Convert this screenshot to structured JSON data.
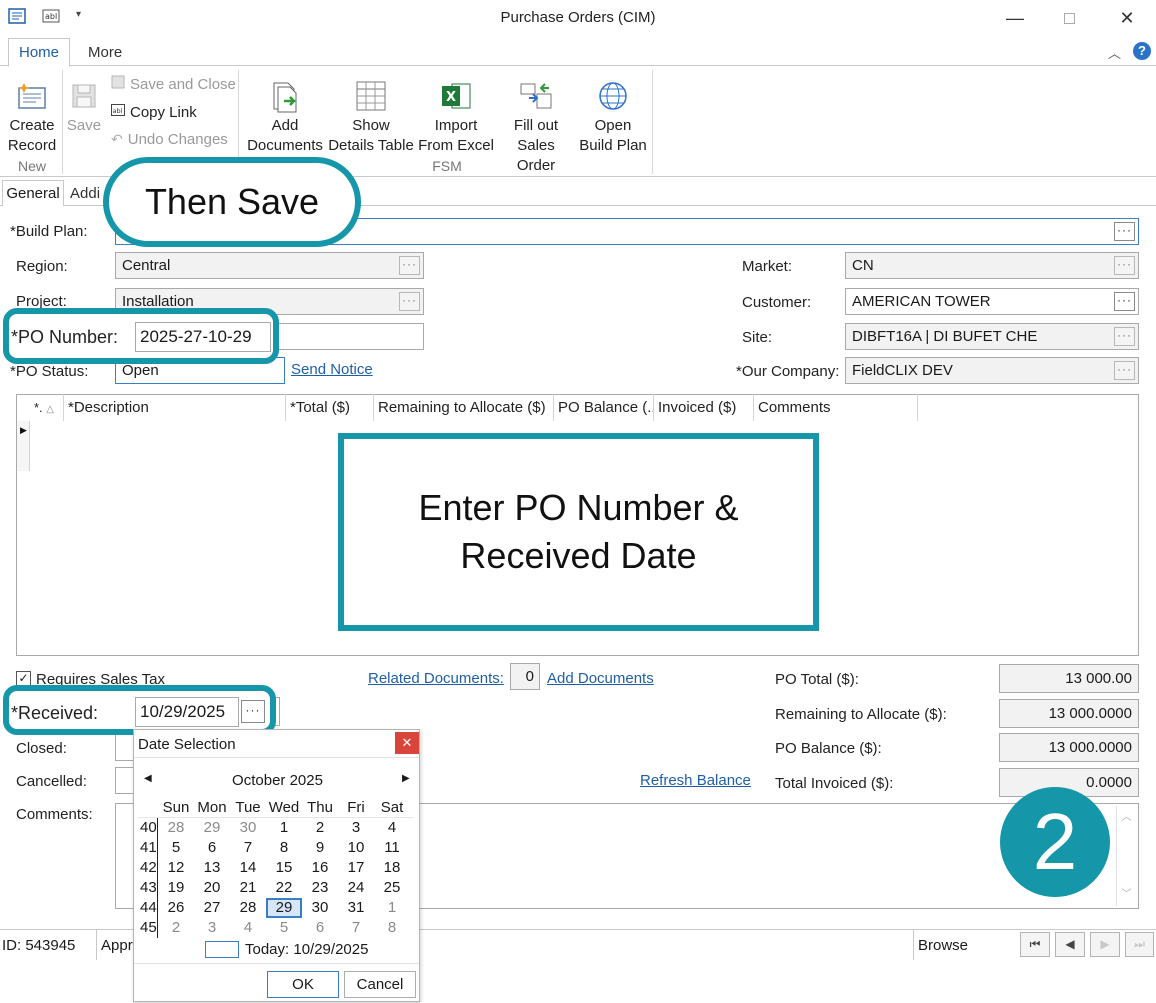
{
  "window": {
    "title": "Purchase Orders (CIM)"
  },
  "ribbon": {
    "tabs": [
      "Home",
      "More"
    ],
    "new_group": {
      "create_record": [
        "Create",
        "Record"
      ],
      "save": "Save",
      "save_and_close": "Save and Close",
      "copy_link": "Copy Link",
      "undo_changes": "Undo Changes",
      "label": "New"
    },
    "fsm_group": {
      "add_documents": [
        "Add",
        "Documents"
      ],
      "show_details": [
        "Show",
        "Details Table"
      ],
      "import_excel": [
        "Import",
        "From Excel"
      ],
      "fill_out": [
        "Fill out",
        "Sales Order"
      ],
      "open_build": [
        "Open",
        "Build Plan"
      ],
      "label": "FSM"
    }
  },
  "form_tabs": [
    "General",
    "Addi"
  ],
  "form": {
    "build_plan_label": "*Build Plan:",
    "region_label": "Region:",
    "region_value": "Central",
    "project_label": "Project:",
    "project_value": "Installation",
    "po_number_label": "*PO Number:",
    "po_number_value": "2025-27-10-29",
    "po_status_label": "*PO Status:",
    "po_status_value": "Open",
    "send_notice": "Send Notice",
    "market_label": "Market:",
    "market_value": "CN",
    "customer_label": "Customer:",
    "customer_value": "AMERICAN TOWER",
    "site_label": "Site:",
    "site_value": "DIBFT16A | DI BUFET CHE",
    "our_company_label": "*Our Company:",
    "our_company_value": "FieldCLIX DEV"
  },
  "grid": {
    "columns": [
      "*.",
      "*Description",
      "*Total ($)",
      "Remaining to Allocate ($)",
      "PO Balance (...",
      "Invoiced ($)",
      "Comments"
    ]
  },
  "lower": {
    "requires_sales_tax": "Requires Sales Tax",
    "related_documents": "Related Documents:",
    "related_count": "0",
    "add_documents": "Add Documents",
    "received_label": "*Received:",
    "received_value": "10/29/2025",
    "closed_label": "Closed:",
    "cancelled_label": "Cancelled:",
    "comments_label": "Comments:",
    "refresh_balance": "Refresh Balance"
  },
  "totals": {
    "po_total_label": "PO Total ($):",
    "po_total": "13 000.00",
    "remaining_label": "Remaining to Allocate ($):",
    "remaining": "13 000.0000",
    "balance_label": "PO Balance ($):",
    "balance": "13 000.0000",
    "invoiced_label": "Total Invoiced ($):",
    "invoiced": "0.0000"
  },
  "calendar": {
    "title": "Date Selection",
    "month": "October 2025",
    "weekdays": [
      "Sun",
      "Mon",
      "Tue",
      "Wed",
      "Thu",
      "Fri",
      "Sat"
    ],
    "weeks": [
      {
        "wk": "40",
        "days": [
          "28",
          "29",
          "30",
          "1",
          "2",
          "3",
          "4"
        ]
      },
      {
        "wk": "41",
        "days": [
          "5",
          "6",
          "7",
          "8",
          "9",
          "10",
          "11"
        ]
      },
      {
        "wk": "42",
        "days": [
          "12",
          "13",
          "14",
          "15",
          "16",
          "17",
          "18"
        ]
      },
      {
        "wk": "43",
        "days": [
          "19",
          "20",
          "21",
          "22",
          "23",
          "24",
          "25"
        ]
      },
      {
        "wk": "44",
        "days": [
          "26",
          "27",
          "28",
          "29",
          "30",
          "31",
          "1"
        ]
      },
      {
        "wk": "45",
        "days": [
          "2",
          "3",
          "4",
          "5",
          "6",
          "7",
          "8"
        ]
      }
    ],
    "selected_day": "29",
    "today": "Today: 10/29/2025",
    "ok": "OK",
    "cancel": "Cancel"
  },
  "status": {
    "id": "ID: 543945",
    "approval": "Appr",
    "mode": "Browse"
  },
  "callouts": {
    "save": "Then Save",
    "enter_line1": "Enter PO Number &",
    "enter_line2": "Received Date",
    "step": "2"
  }
}
